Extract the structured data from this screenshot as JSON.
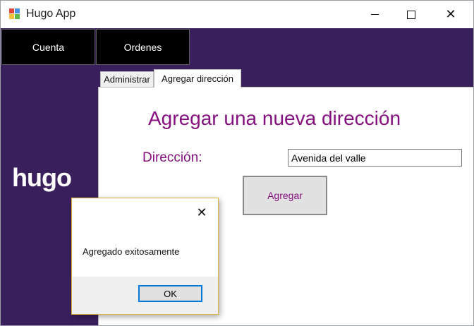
{
  "window": {
    "title": "Hugo App",
    "app_icon": "winforms-app-icon",
    "controls": {
      "minimize": "minimize-icon",
      "maximize": "maximize-icon",
      "close": "close-icon",
      "close_glyph": "✕"
    }
  },
  "nav": {
    "cuenta": "Cuenta",
    "ordenes": "Ordenes"
  },
  "logo": {
    "text": "hugo"
  },
  "tabs": [
    {
      "label": "Administrar",
      "active": false
    },
    {
      "label": "Agregar dirección",
      "active": true
    }
  ],
  "panel": {
    "title": "Agregar una nueva dirección",
    "address_label": "Dirección:",
    "address_value": "Avenida del valle",
    "add_button": "Agregar"
  },
  "dialog": {
    "message": "Agregado exitosamente",
    "ok_label": "OK",
    "close_glyph": "✕"
  },
  "colors": {
    "sidebar_bg": "#3a1f5d",
    "accent_text": "#86107f",
    "nav_bg": "#000000",
    "focus_border": "#0078d7"
  }
}
